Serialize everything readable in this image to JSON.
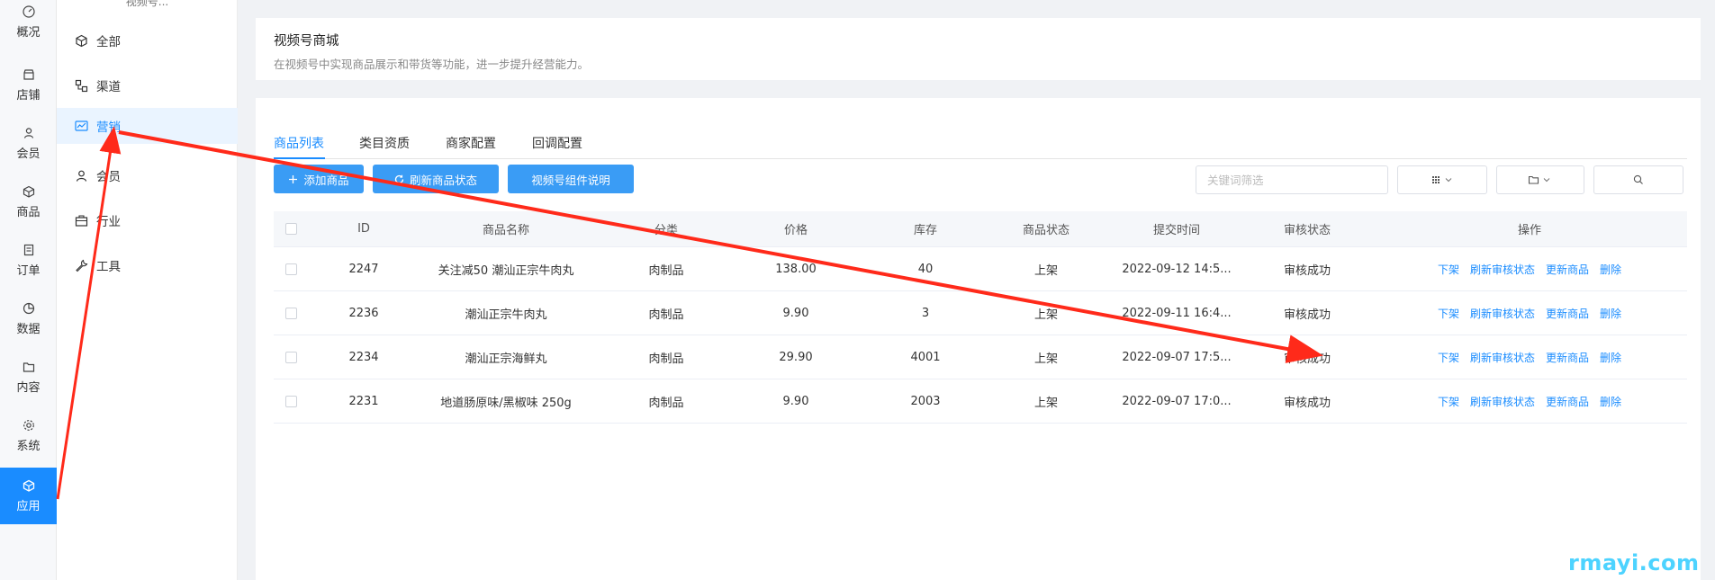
{
  "primary_nav": {
    "items": [
      {
        "label": "概况",
        "icon": "dashboard-icon"
      },
      {
        "label": "店铺",
        "icon": "store-icon"
      },
      {
        "label": "会员",
        "icon": "member-icon"
      },
      {
        "label": "商品",
        "icon": "product-icon"
      },
      {
        "label": "订单",
        "icon": "order-icon"
      },
      {
        "label": "数据",
        "icon": "data-icon"
      },
      {
        "label": "内容",
        "icon": "content-icon"
      },
      {
        "label": "系统",
        "icon": "system-icon"
      },
      {
        "label": "应用",
        "icon": "app-icon",
        "active": true
      }
    ]
  },
  "secondary_nav": {
    "header": "视频号...",
    "items": [
      {
        "label": "全部",
        "icon": "cube-icon"
      },
      {
        "label": "渠道",
        "icon": "channel-icon"
      },
      {
        "label": "营销",
        "icon": "marketing-icon",
        "active": true
      },
      {
        "label": "会员",
        "icon": "member-icon"
      },
      {
        "label": "行业",
        "icon": "industry-icon"
      },
      {
        "label": "工具",
        "icon": "wrench-icon"
      }
    ]
  },
  "intro": {
    "title": "视频号商城",
    "description": "在视频号中实现商品展示和带货等功能，进一步提升经营能力。"
  },
  "tabs": [
    {
      "label": "商品列表",
      "active": true
    },
    {
      "label": "类目资质"
    },
    {
      "label": "商家配置"
    },
    {
      "label": "回调配置"
    }
  ],
  "toolbar": {
    "add_label": "添加商品",
    "refresh_label": "刷新商品状态",
    "guide_label": "视频号组件说明",
    "search_placeholder": "关键词筛选"
  },
  "table": {
    "headers": [
      "ID",
      "商品名称",
      "分类",
      "价格",
      "库存",
      "商品状态",
      "提交时间",
      "审核状态",
      "操作"
    ],
    "rows": [
      {
        "id": "2247",
        "name": "关注减50 潮汕正宗牛肉丸",
        "category": "肉制品",
        "price": "138.00",
        "stock": "40",
        "status": "上架",
        "submit_time": "2022-09-12 14:5...",
        "audit": "审核成功"
      },
      {
        "id": "2236",
        "name": "潮汕正宗牛肉丸",
        "category": "肉制品",
        "price": "9.90",
        "stock": "3",
        "status": "上架",
        "submit_time": "2022-09-11 16:4...",
        "audit": "审核成功"
      },
      {
        "id": "2234",
        "name": "潮汕正宗海鲜丸",
        "category": "肉制品",
        "price": "29.90",
        "stock": "4001",
        "status": "上架",
        "submit_time": "2022-09-07 17:5...",
        "audit": "审核成功"
      },
      {
        "id": "2231",
        "name": "地道肠原味/黑椒味 250g",
        "category": "肉制品",
        "price": "9.90",
        "stock": "2003",
        "status": "上架",
        "submit_time": "2022-09-07 17:0...",
        "audit": "审核成功"
      }
    ],
    "actions": [
      "下架",
      "刷新审核状态",
      "更新商品",
      "删除"
    ]
  },
  "annotation_color": "#ff2a1a",
  "watermark": "rmayi.com"
}
